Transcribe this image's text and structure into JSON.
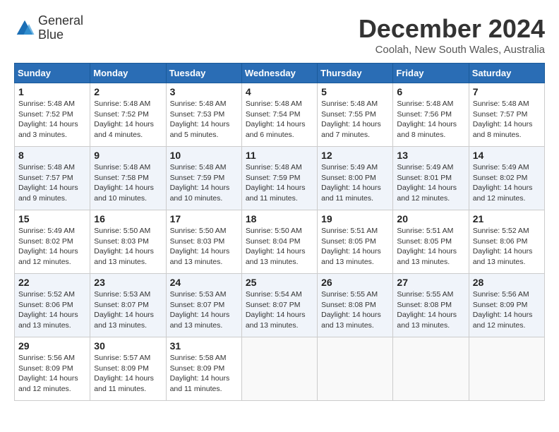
{
  "logo": {
    "general": "General",
    "blue": "Blue"
  },
  "title": "December 2024",
  "location": "Coolah, New South Wales, Australia",
  "days_of_week": [
    "Sunday",
    "Monday",
    "Tuesday",
    "Wednesday",
    "Thursday",
    "Friday",
    "Saturday"
  ],
  "weeks": [
    [
      {
        "day": "1",
        "sunrise": "5:48 AM",
        "sunset": "7:52 PM",
        "daylight": "14 hours and 3 minutes."
      },
      {
        "day": "2",
        "sunrise": "5:48 AM",
        "sunset": "7:52 PM",
        "daylight": "14 hours and 4 minutes."
      },
      {
        "day": "3",
        "sunrise": "5:48 AM",
        "sunset": "7:53 PM",
        "daylight": "14 hours and 5 minutes."
      },
      {
        "day": "4",
        "sunrise": "5:48 AM",
        "sunset": "7:54 PM",
        "daylight": "14 hours and 6 minutes."
      },
      {
        "day": "5",
        "sunrise": "5:48 AM",
        "sunset": "7:55 PM",
        "daylight": "14 hours and 7 minutes."
      },
      {
        "day": "6",
        "sunrise": "5:48 AM",
        "sunset": "7:56 PM",
        "daylight": "14 hours and 8 minutes."
      },
      {
        "day": "7",
        "sunrise": "5:48 AM",
        "sunset": "7:57 PM",
        "daylight": "14 hours and 8 minutes."
      }
    ],
    [
      {
        "day": "8",
        "sunrise": "5:48 AM",
        "sunset": "7:57 PM",
        "daylight": "14 hours and 9 minutes."
      },
      {
        "day": "9",
        "sunrise": "5:48 AM",
        "sunset": "7:58 PM",
        "daylight": "14 hours and 10 minutes."
      },
      {
        "day": "10",
        "sunrise": "5:48 AM",
        "sunset": "7:59 PM",
        "daylight": "14 hours and 10 minutes."
      },
      {
        "day": "11",
        "sunrise": "5:48 AM",
        "sunset": "7:59 PM",
        "daylight": "14 hours and 11 minutes."
      },
      {
        "day": "12",
        "sunrise": "5:49 AM",
        "sunset": "8:00 PM",
        "daylight": "14 hours and 11 minutes."
      },
      {
        "day": "13",
        "sunrise": "5:49 AM",
        "sunset": "8:01 PM",
        "daylight": "14 hours and 12 minutes."
      },
      {
        "day": "14",
        "sunrise": "5:49 AM",
        "sunset": "8:02 PM",
        "daylight": "14 hours and 12 minutes."
      }
    ],
    [
      {
        "day": "15",
        "sunrise": "5:49 AM",
        "sunset": "8:02 PM",
        "daylight": "14 hours and 12 minutes."
      },
      {
        "day": "16",
        "sunrise": "5:50 AM",
        "sunset": "8:03 PM",
        "daylight": "14 hours and 13 minutes."
      },
      {
        "day": "17",
        "sunrise": "5:50 AM",
        "sunset": "8:03 PM",
        "daylight": "14 hours and 13 minutes."
      },
      {
        "day": "18",
        "sunrise": "5:50 AM",
        "sunset": "8:04 PM",
        "daylight": "14 hours and 13 minutes."
      },
      {
        "day": "19",
        "sunrise": "5:51 AM",
        "sunset": "8:05 PM",
        "daylight": "14 hours and 13 minutes."
      },
      {
        "day": "20",
        "sunrise": "5:51 AM",
        "sunset": "8:05 PM",
        "daylight": "14 hours and 13 minutes."
      },
      {
        "day": "21",
        "sunrise": "5:52 AM",
        "sunset": "8:06 PM",
        "daylight": "14 hours and 13 minutes."
      }
    ],
    [
      {
        "day": "22",
        "sunrise": "5:52 AM",
        "sunset": "8:06 PM",
        "daylight": "14 hours and 13 minutes."
      },
      {
        "day": "23",
        "sunrise": "5:53 AM",
        "sunset": "8:07 PM",
        "daylight": "14 hours and 13 minutes."
      },
      {
        "day": "24",
        "sunrise": "5:53 AM",
        "sunset": "8:07 PM",
        "daylight": "14 hours and 13 minutes."
      },
      {
        "day": "25",
        "sunrise": "5:54 AM",
        "sunset": "8:07 PM",
        "daylight": "14 hours and 13 minutes."
      },
      {
        "day": "26",
        "sunrise": "5:55 AM",
        "sunset": "8:08 PM",
        "daylight": "14 hours and 13 minutes."
      },
      {
        "day": "27",
        "sunrise": "5:55 AM",
        "sunset": "8:08 PM",
        "daylight": "14 hours and 13 minutes."
      },
      {
        "day": "28",
        "sunrise": "5:56 AM",
        "sunset": "8:09 PM",
        "daylight": "14 hours and 12 minutes."
      }
    ],
    [
      {
        "day": "29",
        "sunrise": "5:56 AM",
        "sunset": "8:09 PM",
        "daylight": "14 hours and 12 minutes."
      },
      {
        "day": "30",
        "sunrise": "5:57 AM",
        "sunset": "8:09 PM",
        "daylight": "14 hours and 11 minutes."
      },
      {
        "day": "31",
        "sunrise": "5:58 AM",
        "sunset": "8:09 PM",
        "daylight": "14 hours and 11 minutes."
      },
      null,
      null,
      null,
      null
    ]
  ]
}
